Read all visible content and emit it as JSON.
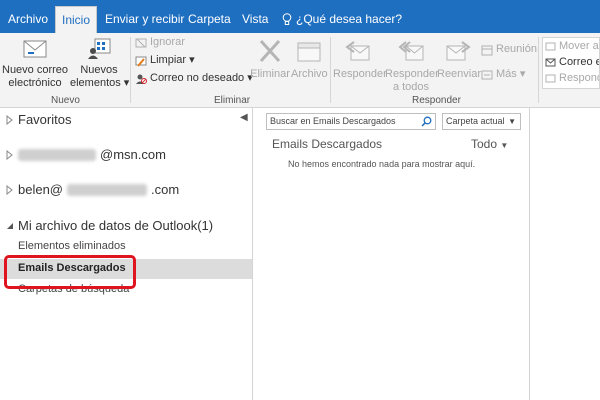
{
  "tabs": [
    {
      "label": "Archivo"
    },
    {
      "label": "Inicio"
    },
    {
      "label": "Enviar y recibir"
    },
    {
      "label": "Carpeta"
    },
    {
      "label": "Vista"
    },
    {
      "label": "¿Qué desea hacer?"
    }
  ],
  "ribbon": {
    "nuevo": {
      "new_email_line1": "Nuevo correo",
      "new_email_line2": "electrónico",
      "new_items_line1": "Nuevos",
      "new_items_line2": "elementos ▾",
      "group_label": "Nuevo"
    },
    "eliminar": {
      "ignore": "Ignorar",
      "clean": "Limpiar ▾",
      "junk": "Correo no deseado ▾",
      "delete": "Eliminar",
      "archive": "Archivo",
      "group_label": "Eliminar"
    },
    "responder": {
      "reply": "Responder",
      "reply_all_line1": "Responder",
      "reply_all_line2": "a todos",
      "forward": "Reenviar",
      "meeting": "Reunión",
      "more": "Más ▾",
      "group_label": "Responder"
    },
    "mover": {
      "move_to": "Mover a",
      "email": "Correo e",
      "reply": "Respond"
    }
  },
  "folders": {
    "favorites": "Favoritos",
    "account1_suffix": "@msn.com",
    "account2_prefix": "belen@",
    "account2_suffix": ".com",
    "datafile": "Mi archivo de datos de Outlook(1)",
    "deleted": "Elementos eliminados",
    "downloaded": "Emails Descargados",
    "search_folders": "Carpetas de búsqueda"
  },
  "list": {
    "search_placeholder": "Buscar en Emails Descargados",
    "scope": "Carpeta actual",
    "title": "Emails Descargados",
    "filter": "Todo",
    "empty": "No hemos encontrado nada para mostrar aquí."
  },
  "colors": {
    "tab_bar": "#1f6fc1",
    "highlight_box": "#e0141e",
    "selected_row": "#dcdcdc"
  }
}
